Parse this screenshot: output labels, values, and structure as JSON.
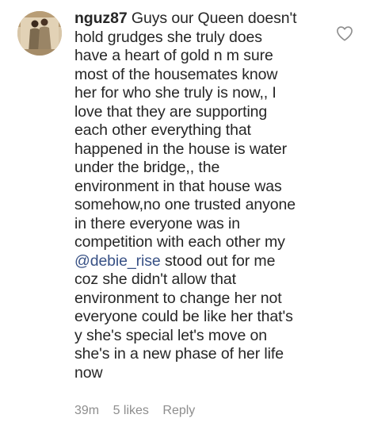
{
  "comment": {
    "username": "nguz87",
    "text_before_mention": " Guys our Queen doesn't\nhold grudges she truly does\nhave a heart of gold n m sure\nmost of the housemates  know\nher for who she truly is now,, I\nlove that they are supporting\neach other everything that\nhappened in the house is water\nunder the bridge,, the\nenvironment in that house was\nsomehow,no one trusted anyone\nin there everyone was in\ncompetition with each other my\n",
    "mention": "@debie_rise",
    "text_after_mention": " stood out for me\ncoz she didn't allow that\nenvironment to change her not\neveryone could be like her that's\ny she's special let's move on\nshe's in a new phase of her life\nnow",
    "time_ago": "39m",
    "likes": "5 likes",
    "reply_label": "Reply",
    "like_icon": "heart-outline-icon",
    "avatar_icon": "profile-photo"
  },
  "colors": {
    "text": "#262626",
    "mention": "#385185",
    "meta": "#8e8e8e",
    "background": "#ffffff"
  }
}
